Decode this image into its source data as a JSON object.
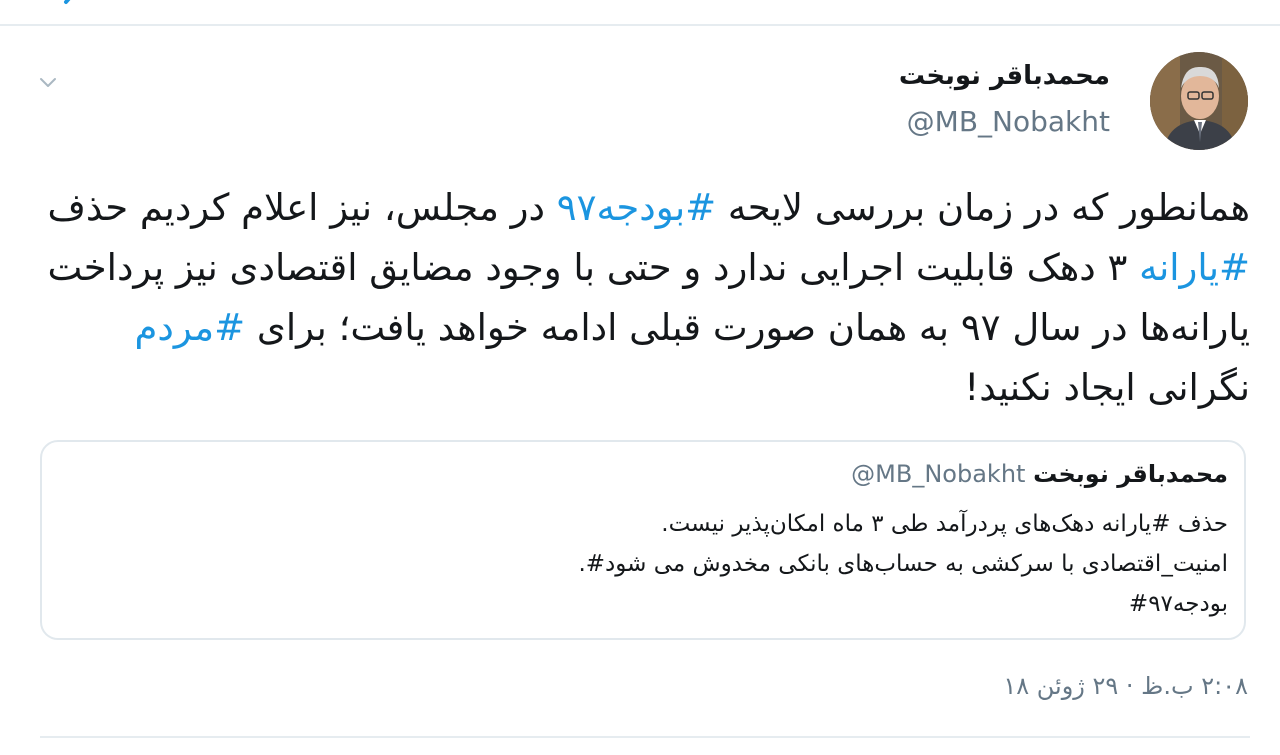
{
  "tweet": {
    "author_name": "محمدباقر نوبخت",
    "author_handle": "@MB_Nobakht",
    "text": {
      "seg1": "همانطور که در زمان بررسی لایحه ",
      "tag1": "#بودجه۹۷",
      "seg2": " در مجلس، نیز اعلام کردیم حذف ",
      "tag2": "#یارانه",
      "seg3": " ۳ دهک قابلیت اجرایی ندارد و حتی با وجود مضایق اقتصادی نیز پرداخت یارانه‌ها در سال ۹۷ به همان صورت قبلی ادامه خواهد یافت؛ برای ",
      "tag3": "#مردم",
      "seg4": " نگرانی ایجاد نکنید!"
    },
    "timestamp": "۲:۰۸ ب.ظ · ۲۹ ژوئن ۱۸"
  },
  "quoted_tweet": {
    "author_name": "محمدباقر نوبخت",
    "author_handle": "@MB_Nobakht",
    "lines": [
      "حذف #یارانه دهک‌های پردرآمد طی ۳ ماه امکان‌پذیر نیست.",
      "امنیت_اقتصادی با سرکشی به حساب‌های بانکی مخدوش می شود#.",
      "بودجه۹۷#"
    ]
  },
  "icons": {
    "menu": "chevron-down-icon",
    "back": "back-arrow-icon"
  },
  "colors": {
    "hashtag": "#1b95e0",
    "secondary_text": "#657786",
    "divider": "#e6ecf0"
  }
}
